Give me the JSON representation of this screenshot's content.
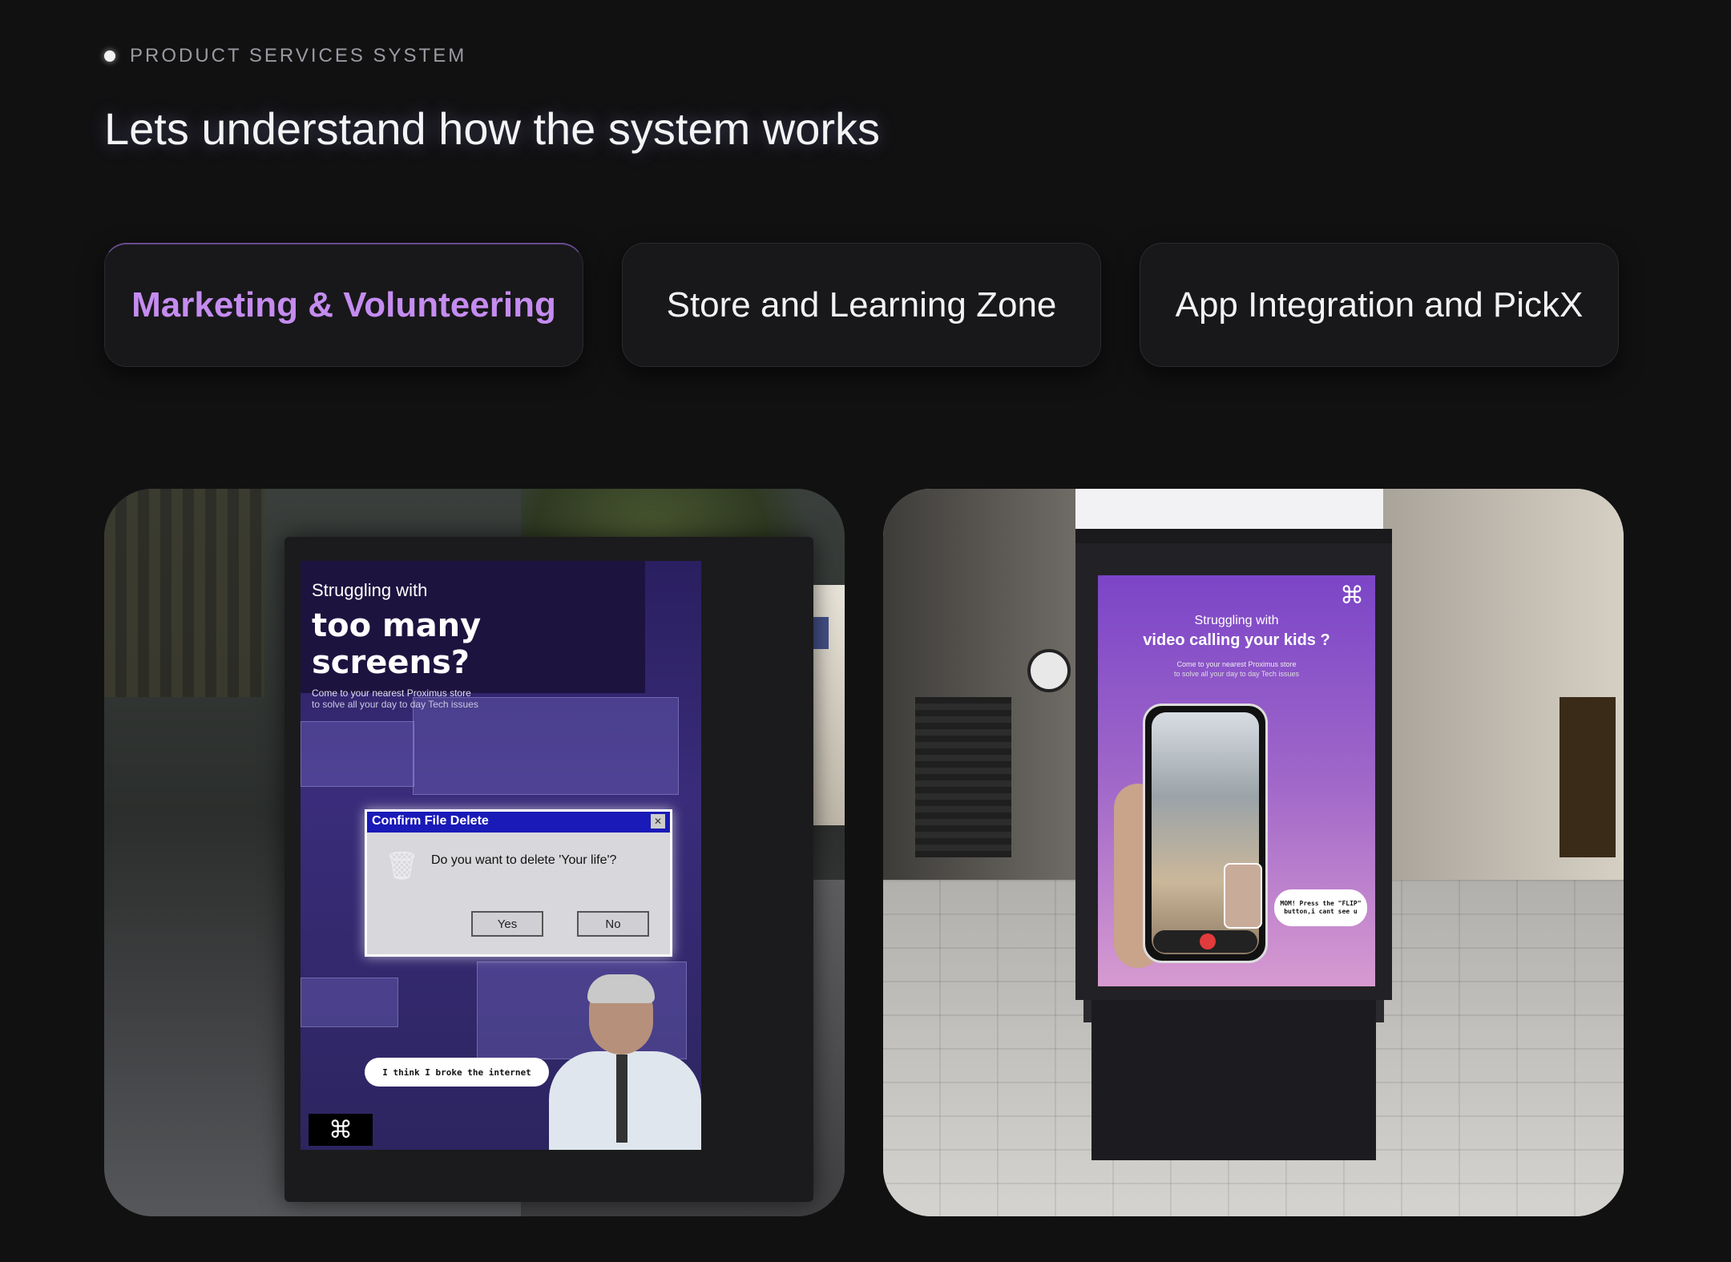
{
  "eyebrow": "PRODUCT SERVICES SYSTEM",
  "headline": "Lets understand how the system works",
  "tabs": [
    {
      "label": "Marketing & Volunteering",
      "active": true
    },
    {
      "label": "Store and Learning Zone",
      "active": false
    },
    {
      "label": "App Integration and PickX",
      "active": false
    }
  ],
  "colors": {
    "background": "#111112",
    "active_tab_text": "#c58cf0",
    "tab_bg": "#18181a"
  },
  "card_left": {
    "line1": "Struggling with",
    "line2": "too many screens?",
    "line3": "Come to your nearest Proximus store",
    "line4": "to solve all your day to day Tech issues",
    "dialog_title": "Confirm File Delete",
    "dialog_message": "Do you want to delete 'Your life'?",
    "dialog_yes": "Yes",
    "dialog_no": "No",
    "bubble": "I think I broke the internet",
    "logo_text": "⌘"
  },
  "card_right": {
    "line1": "Struggling with",
    "line2": "video calling your kids ?",
    "line3": "Come to your nearest Proximus store",
    "line4": "to solve all your day to day Tech issues",
    "bubble": "MOM! Press the \"FLIP\" button,i cant see u",
    "logo_text": "⌘"
  }
}
